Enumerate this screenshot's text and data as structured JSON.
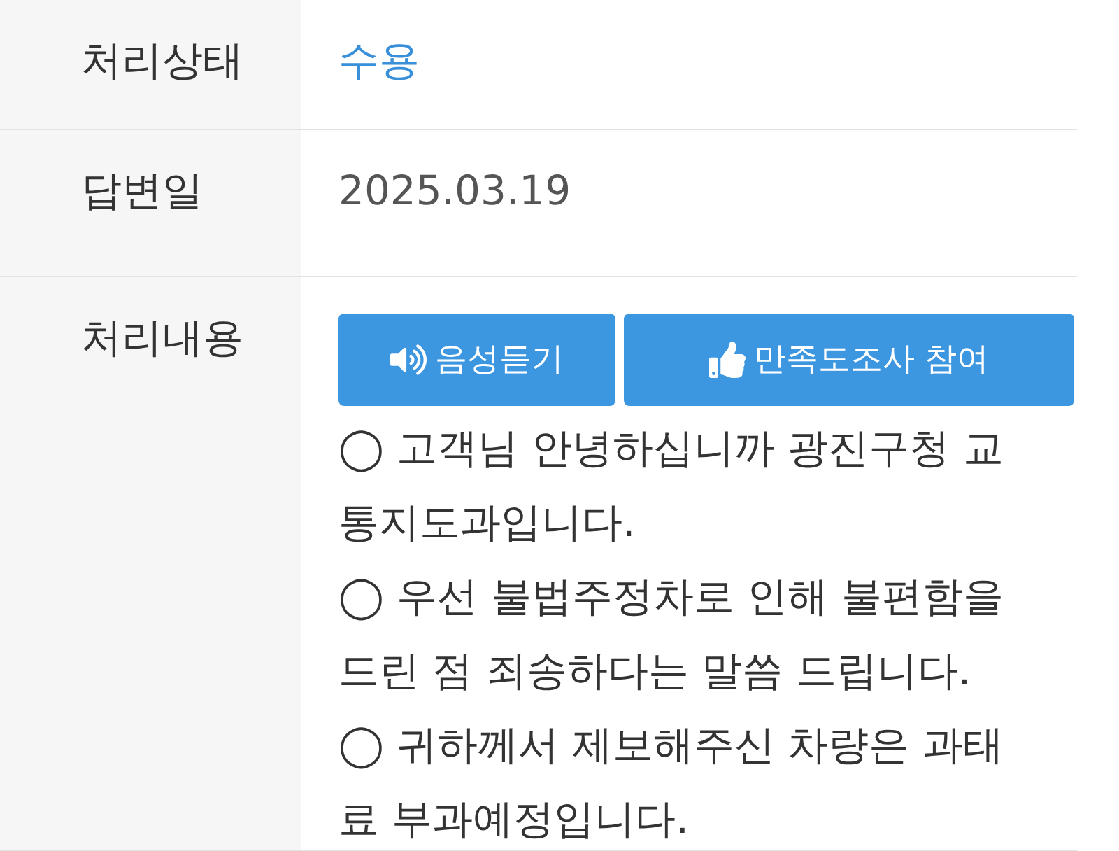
{
  "rows": [
    {
      "kind": "status",
      "label": "처리상태",
      "value": "수용"
    },
    {
      "kind": "text",
      "label": "답변일",
      "value": "2025.03.19"
    },
    {
      "kind": "content",
      "label": "처리내용",
      "buttons": [
        {
          "kind": "listen",
          "label": "음성듣기"
        },
        {
          "kind": "survey",
          "label": "만족도조사 참여"
        }
      ],
      "paragraphs": [
        "◯ 고객님 안녕하십니까 광진구청 교통지도과입니다.",
        "◯ 우선 불법주정차로 인해 불편함을 드린 점 죄송하다는 말씀 드립니다.",
        "◯ 귀하께서 제보해주신 차량은 과태료 부과예정입니다."
      ]
    }
  ]
}
